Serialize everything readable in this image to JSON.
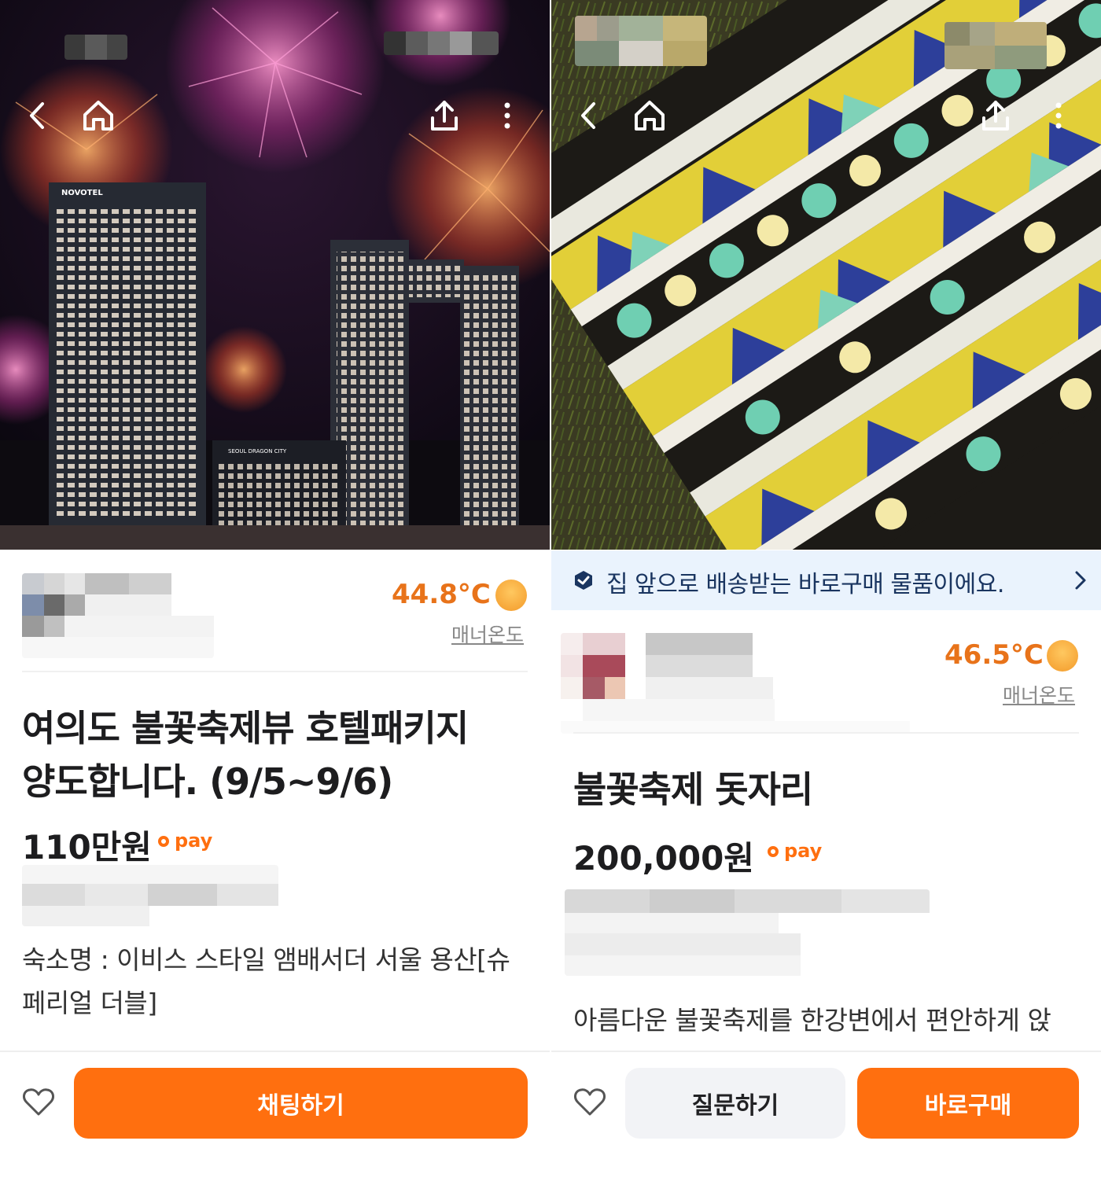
{
  "left": {
    "seller": {
      "temperature": "44.8°C",
      "manner_label": "매너온도"
    },
    "listing": {
      "title_line1": "여의도 불꽃축제뷰 호텔패키지",
      "title_line2": "양도합니다. (9/5~9/6)",
      "price": "110만원",
      "pay_label": "pay",
      "desc_line1": "숙소명 : 이비스 스타일 앰배서더 서울 용산[슈",
      "desc_line2": "페리얼 더블]"
    },
    "hotel_sign_left": "NOVOTEL",
    "hotel_sign_center": "SEOUL DRAGON CITY",
    "actions": {
      "chat_label": "채팅하기"
    }
  },
  "right": {
    "banner": {
      "text": "집 앞으로 배송받는 바로구매 물품이에요."
    },
    "seller": {
      "temperature": "46.5°C",
      "manner_label": "매너온도"
    },
    "listing": {
      "title": "불꽃축제 돗자리",
      "price": "200,000원",
      "pay_label": "pay",
      "desc_line1": "아름다운 불꽃축제를 한강변에서 편안하게 앉"
    },
    "actions": {
      "ask_label": "질문하기",
      "buy_label": "바로구매"
    }
  },
  "colors": {
    "accent": "#ff6f0f",
    "temp": "#e8731a",
    "banner_bg": "#eaf3fd"
  },
  "icons": [
    "back-icon",
    "home-icon",
    "share-icon",
    "more-icon",
    "heart-icon",
    "delivery-box-icon",
    "chevron-right-icon",
    "pay-carrot-icon",
    "temperature-face-icon"
  ]
}
